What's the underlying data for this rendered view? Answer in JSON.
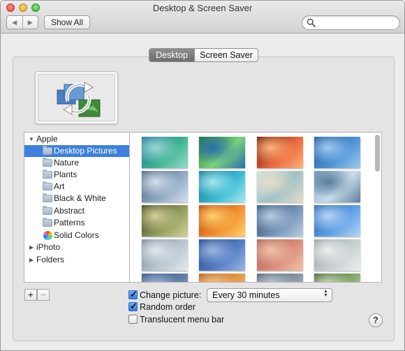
{
  "window": {
    "title": "Desktop & Screen Saver"
  },
  "toolbar": {
    "back_glyph": "◀",
    "forward_glyph": "▶",
    "show_all_label": "Show All",
    "search": {
      "placeholder": "",
      "value": ""
    }
  },
  "tabs": [
    {
      "label": "Desktop",
      "active": true
    },
    {
      "label": "Screen Saver",
      "active": false
    }
  ],
  "preview": {
    "icon": "rotating-refresh-arrows-over-images-icon"
  },
  "sidebar": {
    "groups": [
      {
        "label": "Apple",
        "expanded": true,
        "items": [
          {
            "label": "Desktop Pictures",
            "icon": "folder-icon",
            "selected": true
          },
          {
            "label": "Nature",
            "icon": "folder-icon"
          },
          {
            "label": "Plants",
            "icon": "folder-icon"
          },
          {
            "label": "Art",
            "icon": "folder-icon"
          },
          {
            "label": "Black & White",
            "icon": "folder-icon"
          },
          {
            "label": "Abstract",
            "icon": "folder-icon"
          },
          {
            "label": "Patterns",
            "icon": "folder-icon"
          },
          {
            "label": "Solid Colors",
            "icon": "color-wheel-icon"
          }
        ]
      },
      {
        "label": "iPhoto",
        "expanded": false
      },
      {
        "label": "Folders",
        "expanded": false
      }
    ],
    "add_label": "+",
    "remove_label": "−"
  },
  "thumbnails": [
    {
      "name": "green-wave",
      "colors": [
        "#1d6fa3",
        "#3bb38f",
        "#9ad8d0"
      ]
    },
    {
      "name": "green-abstract",
      "colors": [
        "#1d7a3a",
        "#7ad17a",
        "#2b6fb0"
      ]
    },
    {
      "name": "red-canyon",
      "colors": [
        "#5a1209",
        "#e8663a",
        "#ffb37a"
      ]
    },
    {
      "name": "blue-wave",
      "colors": [
        "#1b4f96",
        "#4a91d4",
        "#9ec9f0"
      ]
    },
    {
      "name": "grey-wave",
      "colors": [
        "#3f5a78",
        "#8aa6c2",
        "#d5e0ea"
      ]
    },
    {
      "name": "turquoise-water",
      "colors": [
        "#0b6f8a",
        "#36b7d0",
        "#a2e8f2"
      ]
    },
    {
      "name": "sand-beach",
      "colors": [
        "#cfe3e6",
        "#9fc1c5",
        "#e6dcc7"
      ]
    },
    {
      "name": "winter-forest",
      "colors": [
        "#7ea6c8",
        "#c9dcea",
        "#5c7f9d"
      ]
    },
    {
      "name": "grass-meadow",
      "colors": [
        "#2d3a19",
        "#8f9a5a",
        "#d8cf9a"
      ]
    },
    {
      "name": "orange-abstract",
      "colors": [
        "#b33a0d",
        "#f08b29",
        "#ffd36b"
      ]
    },
    {
      "name": "blue-grey-texture",
      "colors": [
        "#27466e",
        "#6f8fb3",
        "#b9cde0"
      ]
    },
    {
      "name": "blue-swirl",
      "colors": [
        "#1d5fb0",
        "#5b9ee3",
        "#b6d6f5"
      ]
    },
    {
      "name": "grey-drift",
      "colors": [
        "#6d7f91",
        "#b7c3cf",
        "#e4e9ee"
      ]
    },
    {
      "name": "blue-pattern",
      "colors": [
        "#1f3d80",
        "#4f79c2",
        "#9bb7e2"
      ]
    },
    {
      "name": "pink-dunes",
      "colors": [
        "#a45a54",
        "#d98b77",
        "#f0c3a8"
      ]
    },
    {
      "name": "misty-lake",
      "colors": [
        "#8f9aa0",
        "#c7ced1",
        "#edeff0"
      ]
    },
    {
      "name": "dark-blue-partial",
      "colors": [
        "#33507a",
        "#5d7aa5",
        "#a6bad5"
      ]
    },
    {
      "name": "orange-partial",
      "colors": [
        "#b35a1c",
        "#e59745",
        "#f6c98e"
      ]
    },
    {
      "name": "grey-partial",
      "colors": [
        "#4a5c70",
        "#8697a8",
        "#c4ccd5"
      ]
    },
    {
      "name": "green-partial",
      "colors": [
        "#3a5a2a",
        "#86a86a",
        "#cfe0bf"
      ]
    }
  ],
  "options": {
    "change_picture": {
      "label": "Change picture:",
      "checked": true
    },
    "interval": {
      "selected": "Every 30 minutes"
    },
    "random_order": {
      "label": "Random order",
      "checked": true
    },
    "translucent_menu_bar": {
      "label": "Translucent menu bar",
      "checked": false
    }
  },
  "help_label": "?",
  "checkmark_glyph": "✓",
  "popup_arrows_glyph": "▲▼"
}
